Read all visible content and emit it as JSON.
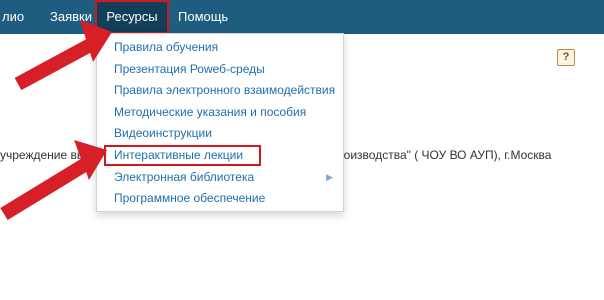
{
  "nav": {
    "items": [
      {
        "label": "лио"
      },
      {
        "label": "Заявки"
      },
      {
        "label": "Ресурсы"
      },
      {
        "label": "Помощь"
      }
    ]
  },
  "help_label": "?",
  "content": {
    "text_left": "учреждение выс",
    "text_right": "роизводства\" ( ЧОУ ВО АУП), г.Москва"
  },
  "menu": {
    "items": [
      {
        "label": "Правила обучения"
      },
      {
        "label": "Презентация Роwеб-среды"
      },
      {
        "label": "Правила электронного взаимодействия"
      },
      {
        "label": "Методические указания и пособия"
      },
      {
        "label": "Видеоинструкции"
      },
      {
        "label": "Интерактивные лекции"
      },
      {
        "label": "Электронная библиотека",
        "submenu_icon": "caret-right-icon"
      },
      {
        "label": "Программное обеспечение"
      }
    ]
  },
  "colors": {
    "nav_bg": "#1f5d80",
    "nav_active_bg": "#113e58",
    "highlight_red": "#d0181f",
    "menu_link": "#1f6fae",
    "arrow_red": "#d61f26"
  }
}
